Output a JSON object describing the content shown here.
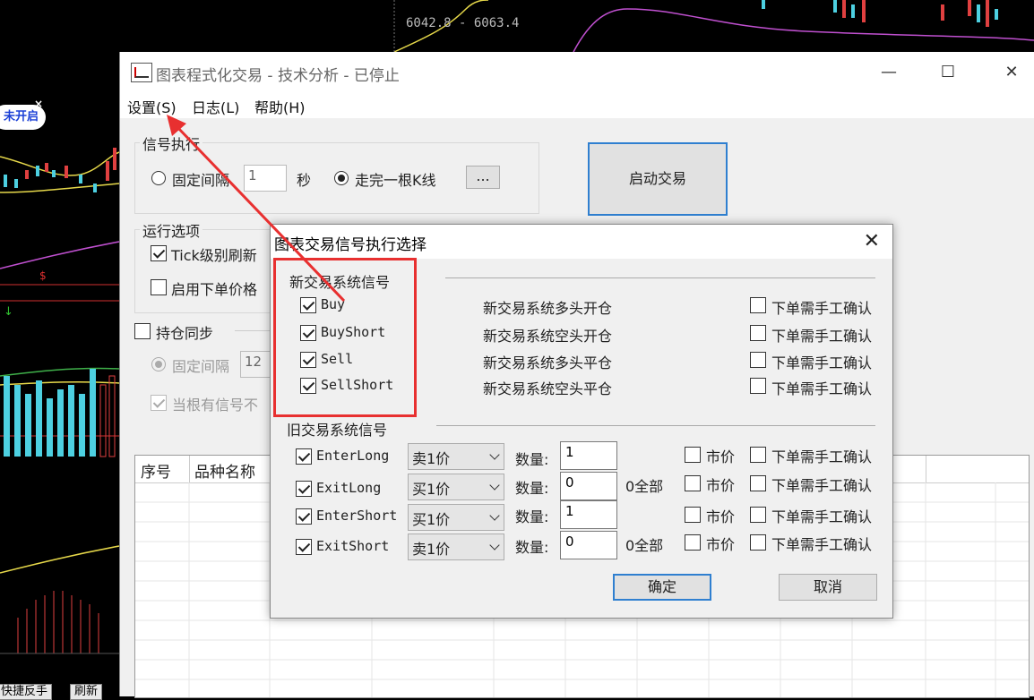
{
  "background_chart": {
    "price_range_text": "6042.8 - 6063.4",
    "pill_text": "未开启",
    "pill_close": "×",
    "bottom_buttons": [
      "快捷反手",
      "刷新"
    ]
  },
  "main_window": {
    "title": "图表程式化交易 - 技术分析 - 已停止",
    "controls": {
      "minimize": "—",
      "maximize": "☐",
      "close": "✕"
    },
    "menu": [
      {
        "label": "设置(S)"
      },
      {
        "label": "日志(L)"
      },
      {
        "label": "帮助(H)"
      }
    ],
    "signal_exec": {
      "group_label": "信号执行",
      "fixed_interval_label": "固定间隔",
      "fixed_interval_value": "1",
      "fixed_interval_unit": "秒",
      "kline_label": "走完一根K线",
      "more_button": "..."
    },
    "start_button": "启动交易",
    "run_options": {
      "group_label": "运行选项",
      "tick_refresh": "Tick级别刷新",
      "order_price": "启用下单价格"
    },
    "position_sync": {
      "label": "持仓同步",
      "fixed_interval_label": "固定间隔",
      "fixed_interval_value": "12",
      "when_signal": "当根有信号不"
    },
    "grid_headers": [
      "序号",
      "品种名称"
    ]
  },
  "dialog": {
    "title": "图表交易信号执行选择",
    "close": "✕",
    "new_signals": {
      "label": "新交易系统信号",
      "rows": [
        {
          "name": "Buy",
          "desc": "新交易系统多头开仓",
          "confirm": "下单需手工确认"
        },
        {
          "name": "BuyShort",
          "desc": "新交易系统空头开仓",
          "confirm": "下单需手工确认"
        },
        {
          "name": "Sell",
          "desc": "新交易系统多头平仓",
          "confirm": "下单需手工确认"
        },
        {
          "name": "SellShort",
          "desc": "新交易系统空头平仓",
          "confirm": "下单需手工确认"
        }
      ]
    },
    "old_signals": {
      "label": "旧交易系统信号",
      "rows": [
        {
          "name": "EnterLong",
          "price": "卖1价",
          "qty_label": "数量:",
          "qty": "1",
          "all": "",
          "market": "市价",
          "confirm": "下单需手工确认"
        },
        {
          "name": "ExitLong",
          "price": "买1价",
          "qty_label": "数量:",
          "qty": "0",
          "all": "0全部",
          "market": "市价",
          "confirm": "下单需手工确认"
        },
        {
          "name": "EnterShort",
          "price": "买1价",
          "qty_label": "数量:",
          "qty": "1",
          "all": "",
          "market": "市价",
          "confirm": "下单需手工确认"
        },
        {
          "name": "ExitShort",
          "price": "卖1价",
          "qty_label": "数量:",
          "qty": "0",
          "all": "0全部",
          "market": "市价",
          "confirm": "下单需手工确认"
        }
      ]
    },
    "ok_button": "确定",
    "cancel_button": "取消"
  },
  "colors": {
    "annotation_red": "#e83030",
    "focus_blue": "#2f7fd0"
  }
}
